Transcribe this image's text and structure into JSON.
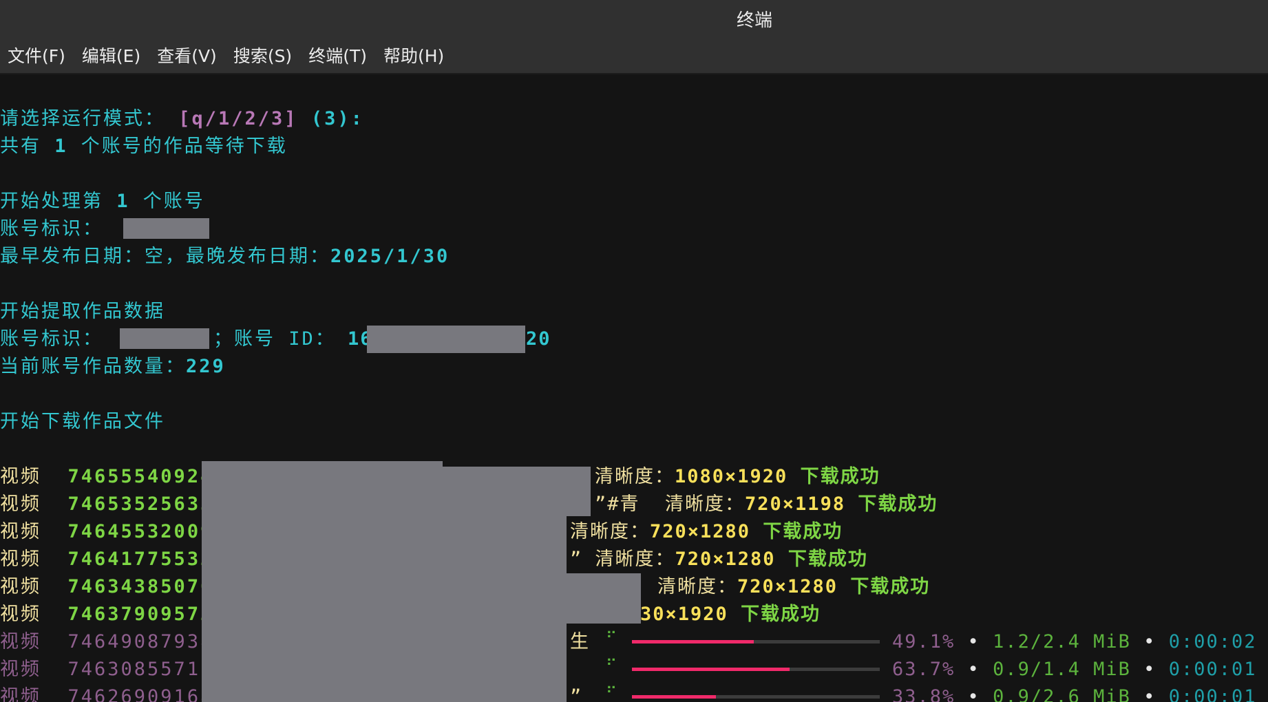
{
  "window": {
    "title": "终端"
  },
  "menu": [
    "文件(F)",
    "编辑(E)",
    "查看(V)",
    "搜索(S)",
    "终端(T)",
    "帮助(H)"
  ],
  "terminal": {
    "prompt_mode_label": "请选择运行模式：",
    "prompt_mode_options": "[q/1/2/3]",
    "prompt_mode_default": "(3):",
    "total_pre": "共有 ",
    "total_count": "1",
    "total_post": " 个账号的作品等待下载",
    "start_pre": "开始处理第 ",
    "start_num": "1",
    "start_post": " 个账号",
    "account_label": "账号标识：",
    "date_label": "最早发布日期：空，最晚发布日期：",
    "date_value": "2025/1/30",
    "extract_label": "开始提取作品数据",
    "account_label2": "账号标识：",
    "account_id_label": "；账号 ID：",
    "account_id_prefix": "16",
    "account_id_suffix": "20",
    "count_label": "当前账号作品数量：",
    "count_value": "229",
    "download_label": "开始下载作品文件"
  },
  "downloads": [
    {
      "kind": "视频",
      "id": "74655540924",
      "tail": "清晰度：",
      "res": "1080×1920",
      "status": "下载成功"
    },
    {
      "kind": "视频",
      "id": "74653525633",
      "tail": "”#青  清晰度：",
      "res": "720×1198",
      "status": "下载成功"
    },
    {
      "kind": "视频",
      "id": "74645532009",
      "tail": "清晰度：",
      "res": "720×1280",
      "status": "下载成功"
    },
    {
      "kind": "视频",
      "id": "74641775532",
      "tail": "” 清晰度：",
      "res": "720×1280",
      "status": "下载成功"
    },
    {
      "kind": "视频",
      "id": "74634385070",
      "tail": "清晰度：",
      "res": "720×1280",
      "status": "下载成功"
    },
    {
      "kind": "视频",
      "id": "74637909572",
      "tail": "",
      "res": "30×1920",
      "status": "下载成功"
    }
  ],
  "progress": [
    {
      "kind": "视频",
      "id": "74649087938",
      "prefix": "生",
      "spinner": "⠋",
      "fill": 0.491,
      "percent": "49.1%",
      "size": "1.2/2.4 MiB",
      "eta": "0:00:02"
    },
    {
      "kind": "视频",
      "id": "74630855711",
      "prefix": "",
      "spinner": "⠋",
      "fill": 0.637,
      "percent": "63.7%",
      "size": "0.9/1.4 MiB",
      "eta": "0:00:01"
    },
    {
      "kind": "视频",
      "id": "74626909168",
      "prefix": "”",
      "spinner": "⠋",
      "fill": 0.338,
      "percent": "33.8%",
      "size": "0.9/2.6 MiB",
      "eta": "0:00:01"
    }
  ],
  "bullet": "•",
  "colors": {
    "background": "#141414",
    "cyan": "#33c7d0",
    "green": "#7ed645",
    "yellow": "#f8e05a",
    "progress": "#f02a6a"
  }
}
